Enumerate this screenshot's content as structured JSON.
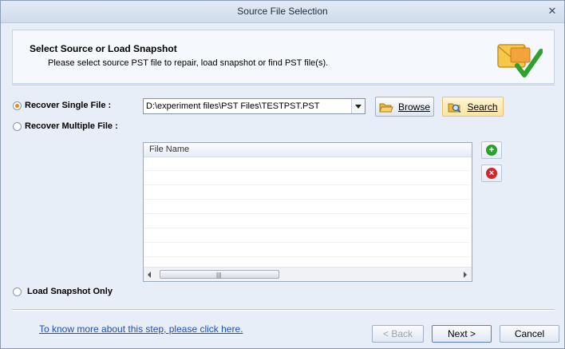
{
  "window": {
    "title": "Source File Selection"
  },
  "header": {
    "title": "Select Source or Load Snapshot",
    "subtitle": "Please select source PST file to repair, load snapshot or find PST file(s)."
  },
  "options": {
    "single": {
      "label": "Recover Single File :",
      "selected": true
    },
    "multiple": {
      "label": "Recover Multiple File :",
      "selected": false
    },
    "snapshot": {
      "label": "Load Snapshot Only",
      "selected": false
    }
  },
  "file_path": {
    "value": "D:\\experiment files\\PST Files\\TESTPST.PST"
  },
  "buttons": {
    "browse": "Browse",
    "search": "Search",
    "back": "< Back",
    "next": "Next >",
    "cancel": "Cancel"
  },
  "file_list": {
    "header": "File Name",
    "rows": []
  },
  "help_link": "To know more about this step, please click here.",
  "icons": {
    "header": "envelope-check-icon",
    "browse": "folder-open-icon",
    "search": "folder-search-icon",
    "add": "add-icon",
    "remove": "remove-icon"
  },
  "colors": {
    "accent_radio": "#e08a1e",
    "link": "#1d4fb5",
    "add": "#2e9e2e",
    "remove": "#d3262b"
  }
}
